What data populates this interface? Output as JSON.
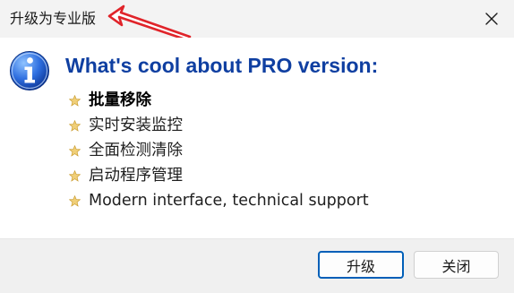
{
  "window": {
    "title": "升级为专业版",
    "close_icon": "close-icon"
  },
  "main": {
    "icon": "info-icon",
    "heading": "What's cool about PRO version:",
    "features": [
      {
        "label": "批量移除",
        "emphasis": true
      },
      {
        "label": "实时安装监控",
        "emphasis": false
      },
      {
        "label": "全面检测清除",
        "emphasis": false
      },
      {
        "label": "启动程序管理",
        "emphasis": false
      },
      {
        "label": "Modern interface, technical support",
        "emphasis": false
      }
    ]
  },
  "footer": {
    "upgrade_label": "升级",
    "close_label": "关闭"
  },
  "colors": {
    "heading": "#0f3fa1",
    "primary_border": "#005fb8",
    "annotation_arrow": "#e0242a",
    "star": "#e8c15a"
  }
}
